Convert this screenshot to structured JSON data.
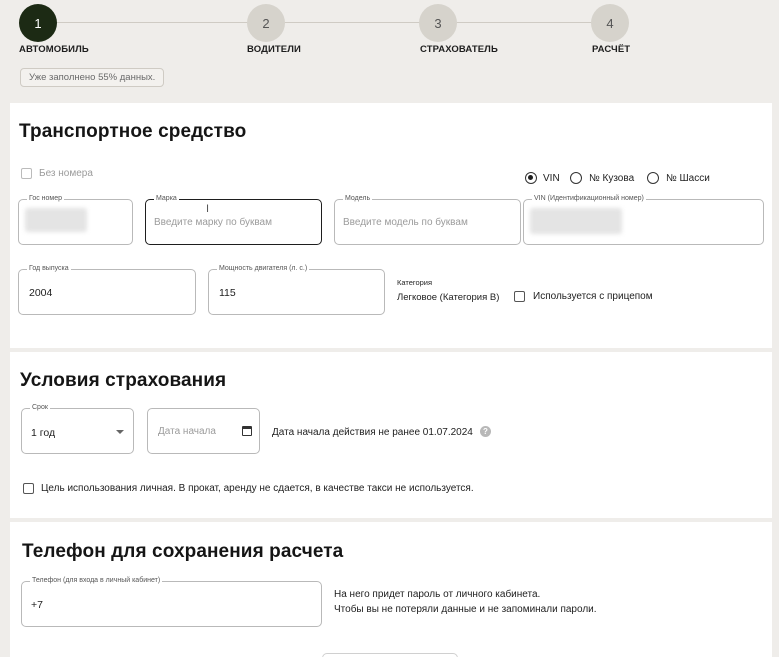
{
  "stepper": {
    "steps": [
      {
        "number": "1",
        "label": "АВТОМОБИЛЬ"
      },
      {
        "number": "2",
        "label": "ВОДИТЕЛИ"
      },
      {
        "number": "3",
        "label": "СТРАХОВАТЕЛЬ"
      },
      {
        "number": "4",
        "label": "РАСЧЁТ"
      }
    ],
    "active_step": 1,
    "progress_text": "Уже заполнено 55% данных."
  },
  "vehicle": {
    "title": "Транспортное средство",
    "no_plate_label": "Без номера",
    "id_type_options": [
      "VIN",
      "№ Кузова",
      "№ Шасси"
    ],
    "id_type_selected": "VIN",
    "plate": {
      "label": "Гос номер",
      "value": ""
    },
    "make": {
      "label": "Марка",
      "placeholder": "Введите марку по буквам"
    },
    "model": {
      "label": "Модель",
      "placeholder": "Введите модель по буквам"
    },
    "vin": {
      "label": "VIN (Идентификационный номер)",
      "value": ""
    },
    "year": {
      "label": "Год выпуска",
      "value": "2004"
    },
    "power": {
      "label": "Мощность двигателя (л. с.)",
      "value": "115"
    },
    "category": {
      "label": "Категория",
      "value": "Легковое (Категория В)"
    },
    "trailer_label": "Используется с прицепом"
  },
  "insurance": {
    "title": "Условия страхования",
    "term": {
      "label": "Срок",
      "value": "1 год"
    },
    "start_date": {
      "placeholder": "Дата начала"
    },
    "start_note": "Дата начала действия не ранее 01.07.2024",
    "purpose_label": "Цель использования личная. В прокат, аренду не сдается, в качестве такси не используется."
  },
  "phone": {
    "title": "Телефон для сохранения расчета",
    "field": {
      "label": "Телефон (для входа в личный кабинет)",
      "value": "+7"
    },
    "note_line1": "На него придет пароль от личного кабинета.",
    "note_line2": "Чтобы вы не потеряли данные и не запоминали пароли."
  }
}
